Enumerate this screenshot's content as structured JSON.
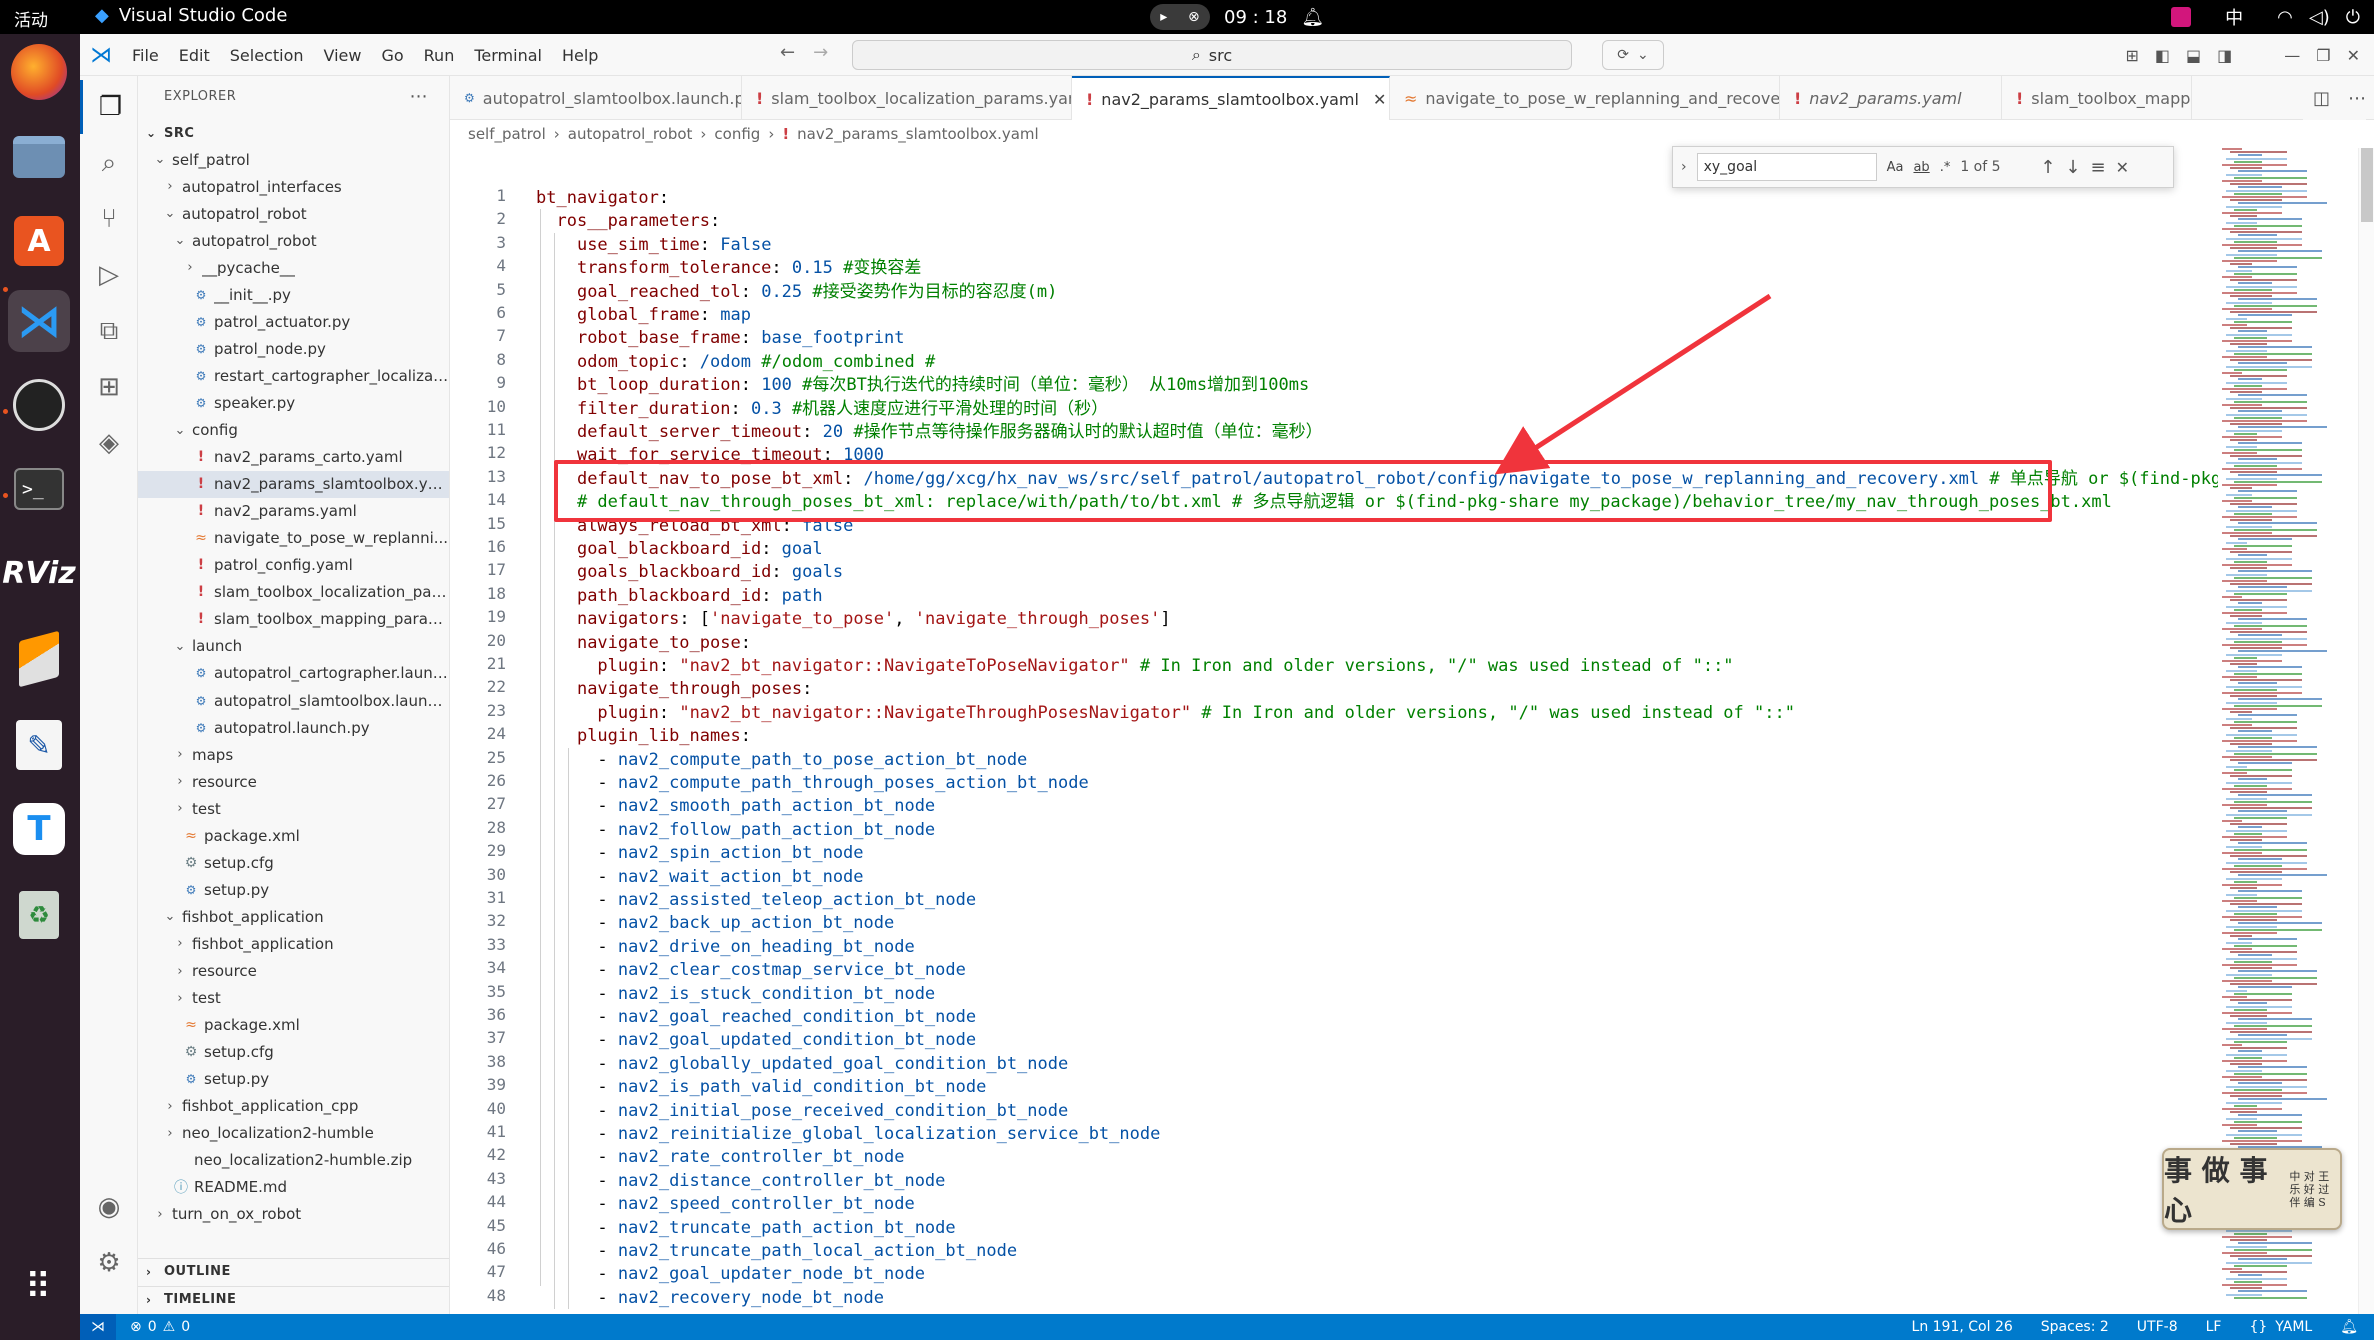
{
  "system": {
    "activities": "活动",
    "app_name": "Visual Studio Code",
    "clock": "09 : 18",
    "ime": "中"
  },
  "menu": [
    "File",
    "Edit",
    "Selection",
    "View",
    "Go",
    "Run",
    "Terminal",
    "Help"
  ],
  "command_center": {
    "text": "src"
  },
  "explorer": {
    "title": "EXPLORER",
    "root": "SRC",
    "tree": [
      {
        "label": "self_patrol",
        "depth": 0,
        "kind": "folder-open"
      },
      {
        "label": "autopatrol_interfaces",
        "depth": 1,
        "kind": "folder-closed"
      },
      {
        "label": "autopatrol_robot",
        "depth": 1,
        "kind": "folder-open"
      },
      {
        "label": "autopatrol_robot",
        "depth": 2,
        "kind": "folder-open"
      },
      {
        "label": "__pycache__",
        "depth": 3,
        "kind": "folder-closed"
      },
      {
        "label": "__init__.py",
        "depth": 3,
        "kind": "py"
      },
      {
        "label": "patrol_actuator.py",
        "depth": 3,
        "kind": "py"
      },
      {
        "label": "patrol_node.py",
        "depth": 3,
        "kind": "py"
      },
      {
        "label": "restart_cartographer_localizati...",
        "depth": 3,
        "kind": "py"
      },
      {
        "label": "speaker.py",
        "depth": 3,
        "kind": "py"
      },
      {
        "label": "config",
        "depth": 2,
        "kind": "folder-open"
      },
      {
        "label": "nav2_params_carto.yaml",
        "depth": 3,
        "kind": "yaml"
      },
      {
        "label": "nav2_params_slamtoolbox.yaml",
        "depth": 3,
        "kind": "yaml",
        "selected": true
      },
      {
        "label": "nav2_params.yaml",
        "depth": 3,
        "kind": "yaml"
      },
      {
        "label": "navigate_to_pose_w_replanni...",
        "depth": 3,
        "kind": "xml"
      },
      {
        "label": "patrol_config.yaml",
        "depth": 3,
        "kind": "yaml"
      },
      {
        "label": "slam_toolbox_localization_par...",
        "depth": 3,
        "kind": "yaml"
      },
      {
        "label": "slam_toolbox_mapping_param...",
        "depth": 3,
        "kind": "yaml"
      },
      {
        "label": "launch",
        "depth": 2,
        "kind": "folder-open"
      },
      {
        "label": "autopatrol_cartographer.launc...",
        "depth": 3,
        "kind": "py"
      },
      {
        "label": "autopatrol_slamtoolbox.launc...",
        "depth": 3,
        "kind": "py"
      },
      {
        "label": "autopatrol.launch.py",
        "depth": 3,
        "kind": "py"
      },
      {
        "label": "maps",
        "depth": 2,
        "kind": "folder-closed"
      },
      {
        "label": "resource",
        "depth": 2,
        "kind": "folder-closed"
      },
      {
        "label": "test",
        "depth": 2,
        "kind": "folder-closed"
      },
      {
        "label": "package.xml",
        "depth": 2,
        "kind": "xml"
      },
      {
        "label": "setup.cfg",
        "depth": 2,
        "kind": "gear"
      },
      {
        "label": "setup.py",
        "depth": 2,
        "kind": "py"
      },
      {
        "label": "fishbot_application",
        "depth": 1,
        "kind": "folder-open"
      },
      {
        "label": "fishbot_application",
        "depth": 2,
        "kind": "folder-closed"
      },
      {
        "label": "resource",
        "depth": 2,
        "kind": "folder-closed"
      },
      {
        "label": "test",
        "depth": 2,
        "kind": "folder-closed"
      },
      {
        "label": "package.xml",
        "depth": 2,
        "kind": "xml"
      },
      {
        "label": "setup.cfg",
        "depth": 2,
        "kind": "gear"
      },
      {
        "label": "setup.py",
        "depth": 2,
        "kind": "py"
      },
      {
        "label": "fishbot_application_cpp",
        "depth": 1,
        "kind": "folder-closed"
      },
      {
        "label": "neo_localization2-humble",
        "depth": 1,
        "kind": "folder-closed"
      },
      {
        "label": "neo_localization2-humble.zip",
        "depth": 1,
        "kind": "zip"
      },
      {
        "label": "README.md",
        "depth": 1,
        "kind": "info"
      },
      {
        "label": "turn_on_ox_robot",
        "depth": 0,
        "kind": "folder-closed"
      }
    ],
    "outline": "OUTLINE",
    "timeline": "TIMELINE"
  },
  "tabs": [
    {
      "label": "autopatrol_slamtoolbox.launch.py",
      "kind": "py"
    },
    {
      "label": "slam_toolbox_localization_params.yaml",
      "kind": "yaml"
    },
    {
      "label": "nav2_params_slamtoolbox.yaml",
      "kind": "yaml",
      "active": true
    },
    {
      "label": "navigate_to_pose_w_replanning_and_recovery.xml",
      "kind": "xml"
    },
    {
      "label": "nav2_params.yaml",
      "kind": "yaml",
      "italic": true
    },
    {
      "label": "slam_toolbox_mapp",
      "kind": "yaml"
    }
  ],
  "breadcrumb": [
    "self_patrol",
    "autopatrol_robot",
    "config",
    "nav2_params_slamtoolbox.yaml"
  ],
  "find": {
    "query": "xy_goal",
    "opt_case": "Aa",
    "opt_word": "ab",
    "opt_regex": ".*",
    "count": "1 of 5"
  },
  "code_lines": [
    [
      [
        "k",
        "bt_navigator"
      ],
      [
        "p",
        ":"
      ]
    ],
    [
      [
        "p",
        "  "
      ],
      [
        "k",
        "ros__parameters"
      ],
      [
        "p",
        ":"
      ]
    ],
    [
      [
        "p",
        "    "
      ],
      [
        "k",
        "use_sim_time"
      ],
      [
        "p",
        ": "
      ],
      [
        "v",
        "False"
      ]
    ],
    [
      [
        "p",
        "    "
      ],
      [
        "k",
        "transform_tolerance"
      ],
      [
        "p",
        ": "
      ],
      [
        "v",
        "0.15"
      ],
      [
        "p",
        " "
      ],
      [
        "c",
        "#变换容差"
      ]
    ],
    [
      [
        "p",
        "    "
      ],
      [
        "k",
        "goal_reached_tol"
      ],
      [
        "p",
        ": "
      ],
      [
        "v",
        "0.25"
      ],
      [
        "p",
        " "
      ],
      [
        "c",
        "#接受姿势作为目标的容忍度(m)"
      ]
    ],
    [
      [
        "p",
        "    "
      ],
      [
        "k",
        "global_frame"
      ],
      [
        "p",
        ": "
      ],
      [
        "v",
        "map"
      ]
    ],
    [
      [
        "p",
        "    "
      ],
      [
        "k",
        "robot_base_frame"
      ],
      [
        "p",
        ": "
      ],
      [
        "v",
        "base_footprint"
      ]
    ],
    [
      [
        "p",
        "    "
      ],
      [
        "k",
        "odom_topic"
      ],
      [
        "p",
        ": "
      ],
      [
        "v",
        "/odom"
      ],
      [
        "p",
        " "
      ],
      [
        "c",
        "#/odom_combined #"
      ]
    ],
    [
      [
        "p",
        "    "
      ],
      [
        "k",
        "bt_loop_duration"
      ],
      [
        "p",
        ": "
      ],
      [
        "v",
        "100"
      ],
      [
        "p",
        " "
      ],
      [
        "c",
        "#每次BT执行迭代的持续时间（单位：毫秒） 从10ms增加到100ms"
      ]
    ],
    [
      [
        "p",
        "    "
      ],
      [
        "k",
        "filter_duration"
      ],
      [
        "p",
        ": "
      ],
      [
        "v",
        "0.3"
      ],
      [
        "p",
        " "
      ],
      [
        "c",
        "#机器人速度应进行平滑处理的时间（秒）"
      ]
    ],
    [
      [
        "p",
        "    "
      ],
      [
        "k",
        "default_server_timeout"
      ],
      [
        "p",
        ": "
      ],
      [
        "v",
        "20"
      ],
      [
        "p",
        " "
      ],
      [
        "c",
        "#操作节点等待操作服务器确认时的默认超时值（单位：毫秒）"
      ]
    ],
    [
      [
        "p",
        "    "
      ],
      [
        "k",
        "wait_for_service_timeout"
      ],
      [
        "p",
        ": "
      ],
      [
        "v",
        "1000"
      ]
    ],
    [
      [
        "p",
        "    "
      ],
      [
        "k",
        "default_nav_to_pose_bt_xml"
      ],
      [
        "p",
        ": "
      ],
      [
        "v",
        "/home/gg/xcg/hx_nav_ws/src/self_patrol/autopatrol_robot/config/navigate_to_pose_w_replanning_and_recovery.xml"
      ],
      [
        "p",
        " "
      ],
      [
        "c",
        "# 单点导航 or $(find-pkg-share my_package)/behavior_tree/my_nav_to_pose_bt.xml"
      ]
    ],
    [
      [
        "p",
        "    "
      ],
      [
        "c",
        "# default_nav_through_poses_bt_xml: replace/with/path/to/bt.xml # 多点导航逻辑 or $(find-pkg-share my_package)/behavior_tree/my_nav_through_poses_bt.xml"
      ]
    ],
    [
      [
        "p",
        "    "
      ],
      [
        "k",
        "always_reload_bt_xml"
      ],
      [
        "p",
        ": "
      ],
      [
        "v",
        "false"
      ]
    ],
    [
      [
        "p",
        "    "
      ],
      [
        "k",
        "goal_blackboard_id"
      ],
      [
        "p",
        ": "
      ],
      [
        "v",
        "goal"
      ]
    ],
    [
      [
        "p",
        "    "
      ],
      [
        "k",
        "goals_blackboard_id"
      ],
      [
        "p",
        ": "
      ],
      [
        "v",
        "goals"
      ]
    ],
    [
      [
        "p",
        "    "
      ],
      [
        "k",
        "path_blackboard_id"
      ],
      [
        "p",
        ": "
      ],
      [
        "v",
        "path"
      ]
    ],
    [
      [
        "p",
        "    "
      ],
      [
        "k",
        "navigators"
      ],
      [
        "p",
        ": ["
      ],
      [
        "s",
        "'navigate_to_pose'"
      ],
      [
        "p",
        ", "
      ],
      [
        "s",
        "'navigate_through_poses'"
      ],
      [
        "p",
        "]"
      ]
    ],
    [
      [
        "p",
        "    "
      ],
      [
        "k",
        "navigate_to_pose"
      ],
      [
        "p",
        ":"
      ]
    ],
    [
      [
        "p",
        "      "
      ],
      [
        "k",
        "plugin"
      ],
      [
        "p",
        ": "
      ],
      [
        "s",
        "\"nav2_bt_navigator::NavigateToPoseNavigator\""
      ],
      [
        "p",
        " "
      ],
      [
        "c",
        "# In Iron and older versions, \"/\" was used instead of \"::\""
      ]
    ],
    [
      [
        "p",
        "    "
      ],
      [
        "k",
        "navigate_through_poses"
      ],
      [
        "p",
        ":"
      ]
    ],
    [
      [
        "p",
        "      "
      ],
      [
        "k",
        "plugin"
      ],
      [
        "p",
        ": "
      ],
      [
        "s",
        "\"nav2_bt_navigator::NavigateThroughPosesNavigator\""
      ],
      [
        "p",
        " "
      ],
      [
        "c",
        "# In Iron and older versions, \"/\" was used instead of \"::\""
      ]
    ],
    [
      [
        "p",
        "    "
      ],
      [
        "k",
        "plugin_lib_names"
      ],
      [
        "p",
        ":"
      ]
    ],
    [
      [
        "p",
        "      - "
      ],
      [
        "v",
        "nav2_compute_path_to_pose_action_bt_node"
      ]
    ],
    [
      [
        "p",
        "      - "
      ],
      [
        "v",
        "nav2_compute_path_through_poses_action_bt_node"
      ]
    ],
    [
      [
        "p",
        "      - "
      ],
      [
        "v",
        "nav2_smooth_path_action_bt_node"
      ]
    ],
    [
      [
        "p",
        "      - "
      ],
      [
        "v",
        "nav2_follow_path_action_bt_node"
      ]
    ],
    [
      [
        "p",
        "      - "
      ],
      [
        "v",
        "nav2_spin_action_bt_node"
      ]
    ],
    [
      [
        "p",
        "      - "
      ],
      [
        "v",
        "nav2_wait_action_bt_node"
      ]
    ],
    [
      [
        "p",
        "      - "
      ],
      [
        "v",
        "nav2_assisted_teleop_action_bt_node"
      ]
    ],
    [
      [
        "p",
        "      - "
      ],
      [
        "v",
        "nav2_back_up_action_bt_node"
      ]
    ],
    [
      [
        "p",
        "      - "
      ],
      [
        "v",
        "nav2_drive_on_heading_bt_node"
      ]
    ],
    [
      [
        "p",
        "      - "
      ],
      [
        "v",
        "nav2_clear_costmap_service_bt_node"
      ]
    ],
    [
      [
        "p",
        "      - "
      ],
      [
        "v",
        "nav2_is_stuck_condition_bt_node"
      ]
    ],
    [
      [
        "p",
        "      - "
      ],
      [
        "v",
        "nav2_goal_reached_condition_bt_node"
      ]
    ],
    [
      [
        "p",
        "      - "
      ],
      [
        "v",
        "nav2_goal_updated_condition_bt_node"
      ]
    ],
    [
      [
        "p",
        "      - "
      ],
      [
        "v",
        "nav2_globally_updated_goal_condition_bt_node"
      ]
    ],
    [
      [
        "p",
        "      - "
      ],
      [
        "v",
        "nav2_is_path_valid_condition_bt_node"
      ]
    ],
    [
      [
        "p",
        "      - "
      ],
      [
        "v",
        "nav2_initial_pose_received_condition_bt_node"
      ]
    ],
    [
      [
        "p",
        "      - "
      ],
      [
        "v",
        "nav2_reinitialize_global_localization_service_bt_node"
      ]
    ],
    [
      [
        "p",
        "      - "
      ],
      [
        "v",
        "nav2_rate_controller_bt_node"
      ]
    ],
    [
      [
        "p",
        "      - "
      ],
      [
        "v",
        "nav2_distance_controller_bt_node"
      ]
    ],
    [
      [
        "p",
        "      - "
      ],
      [
        "v",
        "nav2_speed_controller_bt_node"
      ]
    ],
    [
      [
        "p",
        "      - "
      ],
      [
        "v",
        "nav2_truncate_path_action_bt_node"
      ]
    ],
    [
      [
        "p",
        "      - "
      ],
      [
        "v",
        "nav2_truncate_path_local_action_bt_node"
      ]
    ],
    [
      [
        "p",
        "      - "
      ],
      [
        "v",
        "nav2_goal_updater_node_bt_node"
      ]
    ],
    [
      [
        "p",
        "      - "
      ],
      [
        "v",
        "nav2_recovery_node_bt_node"
      ]
    ]
  ],
  "watermark": {
    "big": "事 做 事 心",
    "small": "中 对 王 乐 好 过 伴 编 S"
  },
  "status": {
    "errors": "0",
    "warnings": "0",
    "position": "Ln 191, Col 26",
    "spaces": "Spaces: 2",
    "encoding": "UTF-8",
    "eol": "LF",
    "language": "YAML"
  },
  "colors": {
    "accent": "#007acc",
    "highlight_box": "#f0343c",
    "keyword": "#800000",
    "value": "#0451a5",
    "string": "#a31515",
    "comment": "#008000"
  }
}
